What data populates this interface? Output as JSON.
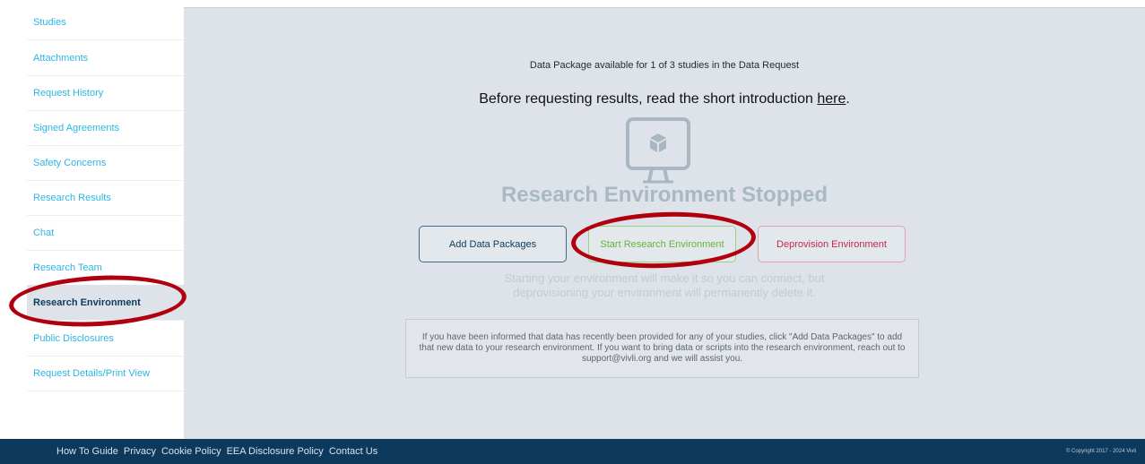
{
  "sidebar": {
    "items": [
      {
        "label": "Studies"
      },
      {
        "label": "Attachments"
      },
      {
        "label": "Request History"
      },
      {
        "label": "Signed Agreements"
      },
      {
        "label": "Safety Concerns"
      },
      {
        "label": "Research Results"
      },
      {
        "label": "Chat"
      },
      {
        "label": "Research Team"
      },
      {
        "label": "Research Environment",
        "active": true
      },
      {
        "label": "Public Disclosures"
      },
      {
        "label": "Request Details/Print View"
      }
    ]
  },
  "main": {
    "availability_text": "Data Package available for 1 of 3 studies in the Data Request",
    "intro_prefix": "Before requesting results, read the short introduction ",
    "intro_link": "here",
    "intro_suffix": ".",
    "status_title": "Research Environment Stopped",
    "buttons": {
      "add": "Add Data Packages",
      "start": "Start Research Environment",
      "deprovision": "Deprovision Environment"
    },
    "hint_line1": "Starting your environment will make it so you can connect, but",
    "hint_line2": "deprovisioning your environment will permanently delete it.",
    "info_text": "If you have been informed that data has recently been provided for any of your studies, click \"Add Data Packages\" to add that new data to your research environment. If you want to bring data or scripts into the research environment, reach out to support@vivli.org and we will assist you."
  },
  "footer": {
    "links": [
      "How To Guide",
      "Privacy",
      "Cookie Policy",
      "EEA Disclosure Policy",
      "Contact Us"
    ],
    "copyright": "© Copyright 2017 - 2024 Vivli"
  },
  "colors": {
    "accent": "#2cb5e3",
    "footer_bg": "#0d3a5c",
    "annotation_ring": "#b0000f"
  }
}
